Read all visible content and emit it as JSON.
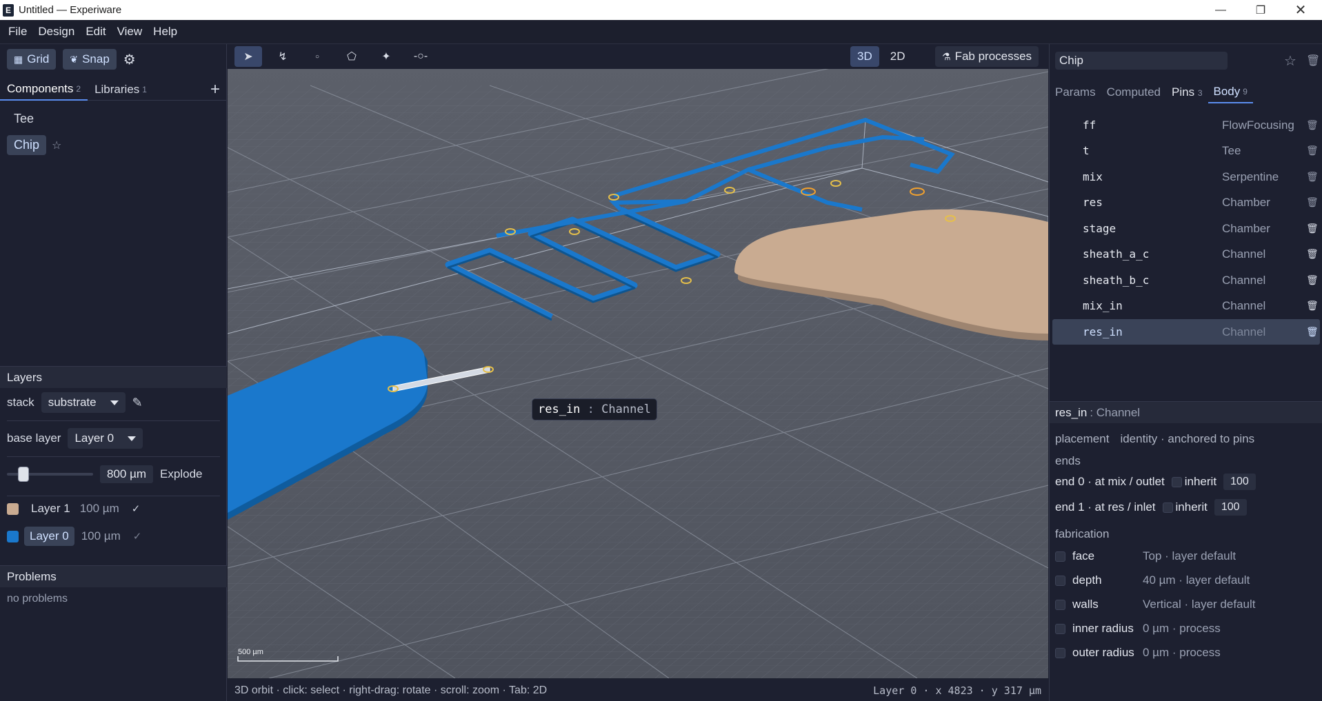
{
  "window": {
    "title": "Untitled — Experiware",
    "app_icon": "E"
  },
  "menu": [
    "File",
    "Design",
    "Edit",
    "View",
    "Help"
  ],
  "left": {
    "grid_label": "Grid",
    "snap_label": "Snap",
    "tabs": [
      {
        "label": "Components",
        "count": "2"
      },
      {
        "label": "Libraries",
        "count": "1"
      }
    ],
    "components": [
      "Tee",
      "Chip"
    ],
    "layers": {
      "title": "Layers",
      "stack_label": "stack",
      "stack_value": "substrate",
      "base_label": "base layer",
      "base_value": "Layer 0",
      "explode_value": "800 µm",
      "explode_label": "Explode",
      "items": [
        {
          "name": "Layer 1",
          "thickness": "100 µm",
          "color": "#c9ab91"
        },
        {
          "name": "Layer 0",
          "thickness": "100 µm",
          "color": "#1a78cc"
        }
      ]
    },
    "problems": {
      "title": "Problems",
      "text": "no problems"
    }
  },
  "toolbar": {
    "view_3d": "3D",
    "view_2d": "2D",
    "fab_label": "Fab processes"
  },
  "viewport": {
    "tooltip_name": "res_in",
    "tooltip_sep": ":",
    "tooltip_type": "Channel",
    "scale_label": "500 µm"
  },
  "status": {
    "left": "3D orbit · click: select · right-drag: rotate · scroll: zoom · Tab: 2D",
    "right": "Layer 0 · x 4823 · y 317 µm"
  },
  "right": {
    "component_name": "Chip",
    "tabs": [
      {
        "label": "Params",
        "count": ""
      },
      {
        "label": "Computed",
        "count": ""
      },
      {
        "label": "Pins",
        "count": "3"
      },
      {
        "label": "Body",
        "count": "9"
      }
    ],
    "body": [
      {
        "name": "ff",
        "type": "FlowFocusing"
      },
      {
        "name": "t",
        "type": "Tee"
      },
      {
        "name": "mix",
        "type": "Serpentine"
      },
      {
        "name": "res",
        "type": "Chamber"
      },
      {
        "name": "stage",
        "type": "Chamber"
      },
      {
        "name": "sheath_a_c",
        "type": "Channel"
      },
      {
        "name": "sheath_b_c",
        "type": "Channel"
      },
      {
        "name": "mix_in",
        "type": "Channel"
      },
      {
        "name": "res_in",
        "type": "Channel"
      }
    ],
    "detail": {
      "name": "res_in",
      "type": ": Channel",
      "placement_label": "placement",
      "placement_value": "identity · anchored to pins",
      "ends_label": "ends",
      "end0_label": "end 0 · at mix / outlet",
      "end0_inherit": "inherit",
      "end0_value": "100",
      "end1_label": "end 1 · at res / inlet",
      "end1_inherit": "inherit",
      "end1_value": "100",
      "fab_label": "fabrication",
      "fab": [
        {
          "label": "face",
          "value": "Top · layer default"
        },
        {
          "label": "depth",
          "value": "40 µm · layer default"
        },
        {
          "label": "walls",
          "value": "Vertical · layer default"
        },
        {
          "label": "inner radius",
          "value": "0 µm · process"
        },
        {
          "label": "outer radius",
          "value": "0 µm · process"
        }
      ]
    }
  },
  "colors": {
    "accent": "#5b8ef0",
    "channel": "#1a78cc",
    "chamber_tan": "#c9ab91",
    "selected_row": "#3a4358"
  }
}
